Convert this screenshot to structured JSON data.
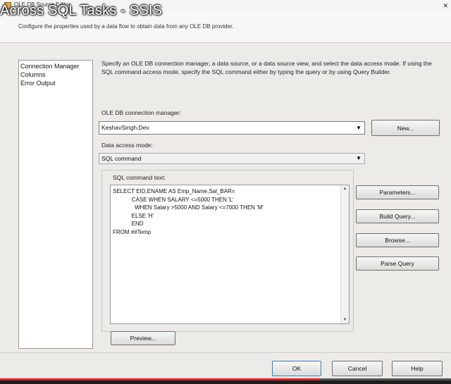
{
  "window": {
    "title": "OLE DB Source Editor",
    "overlay_title": "Across SQL Tasks - SSIS",
    "subtitle": "Configure the properties used by a data flow to obtain data from any OLE DB provider."
  },
  "nav": {
    "items": [
      {
        "label": "Connection Manager"
      },
      {
        "label": "Columns"
      },
      {
        "label": "Error Output"
      }
    ]
  },
  "main": {
    "description": "Specify an OLE DB connection manager, a data source, or a data source view, and select the data access mode. If using the SQL command access mode, specify the SQL command either by typing the query or by using Query Builder.",
    "connection_label": "OLE DB connection manager:",
    "connection_value": "KeshavSingh.Dev",
    "new_button": "New...",
    "access_mode_label": "Data access mode:",
    "access_mode_value": "SQL command",
    "sql_label": "SQL command text:",
    "sql_text": "SELECT EID,ENAME AS Emp_Name,Sal_BAR=\n            CASE WHEN SALARY <=5000 THEN 'L'\n              WHEN Salary >5000 AND Salary <=7000 THEN 'M'\n            ELSE 'H'\n            END\nFROM ##Temp",
    "buttons": {
      "parameters": "Parameters...",
      "build_query": "Build Query...",
      "browse": "Browse...",
      "parse_query": "Parse Query",
      "preview": "Preview..."
    }
  },
  "footer": {
    "ok": "OK",
    "cancel": "Cancel",
    "help": "Help"
  },
  "video": {
    "progress_fraction": 0.71
  }
}
